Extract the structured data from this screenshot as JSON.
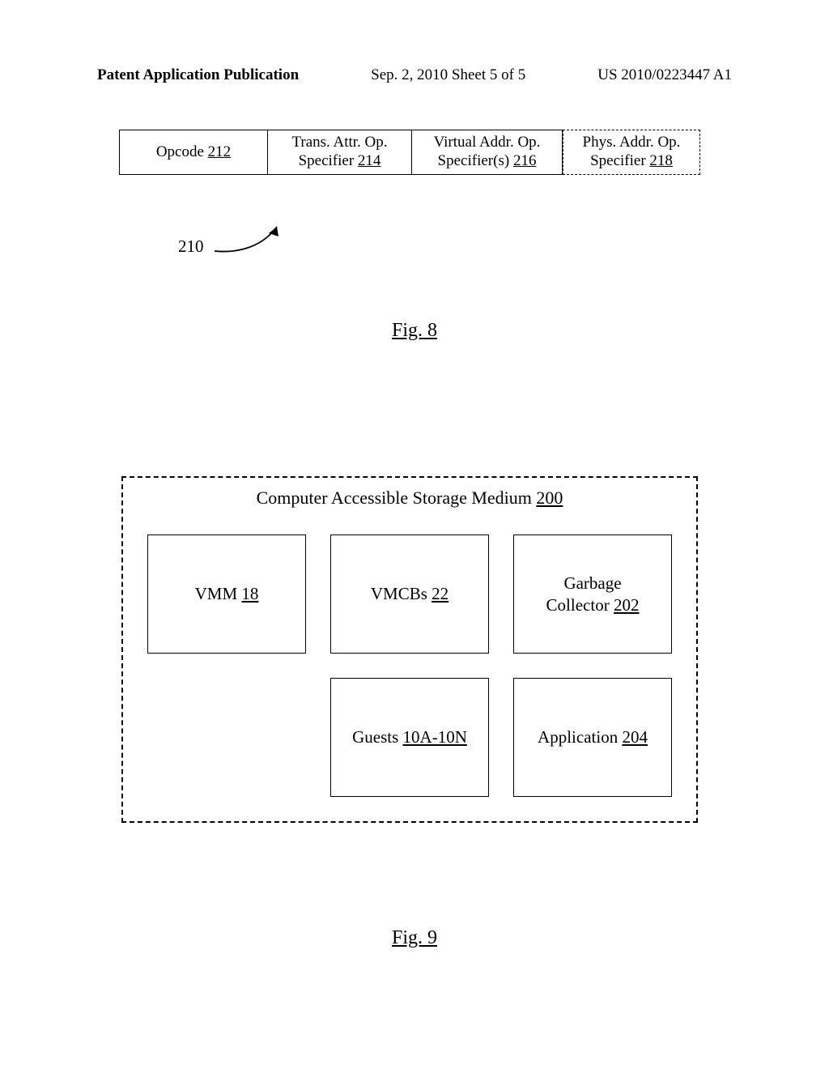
{
  "header": {
    "left": "Patent Application Publication",
    "center": "Sep. 2, 2010  Sheet 5 of 5",
    "right": "US 2010/0223447 A1"
  },
  "fig8": {
    "cells": [
      {
        "line1": "Opcode ",
        "num": "212",
        "oneLine": true
      },
      {
        "line1": "Trans. Attr. Op.",
        "line2": "Specifier ",
        "num": "214"
      },
      {
        "line1": "Virtual Addr. Op.",
        "line2": "Specifier(s) ",
        "num": "216"
      },
      {
        "line1": "Phys. Addr. Op.",
        "line2": "Specifier ",
        "num": "218"
      }
    ],
    "ref": "210",
    "caption": "Fig. 8"
  },
  "fig9": {
    "title_pre": "Computer Accessible Storage Medium ",
    "title_num": "200",
    "cells": {
      "vmm": {
        "label": "VMM ",
        "num": "18"
      },
      "vmcbs": {
        "label": "VMCBs ",
        "num": "22"
      },
      "gc": {
        "label1": "Garbage",
        "label2": "Collector ",
        "num": "202"
      },
      "guests": {
        "label": "Guests ",
        "num": "10A-10N"
      },
      "app": {
        "label": "Application ",
        "num": "204"
      }
    },
    "caption": "Fig. 9"
  }
}
